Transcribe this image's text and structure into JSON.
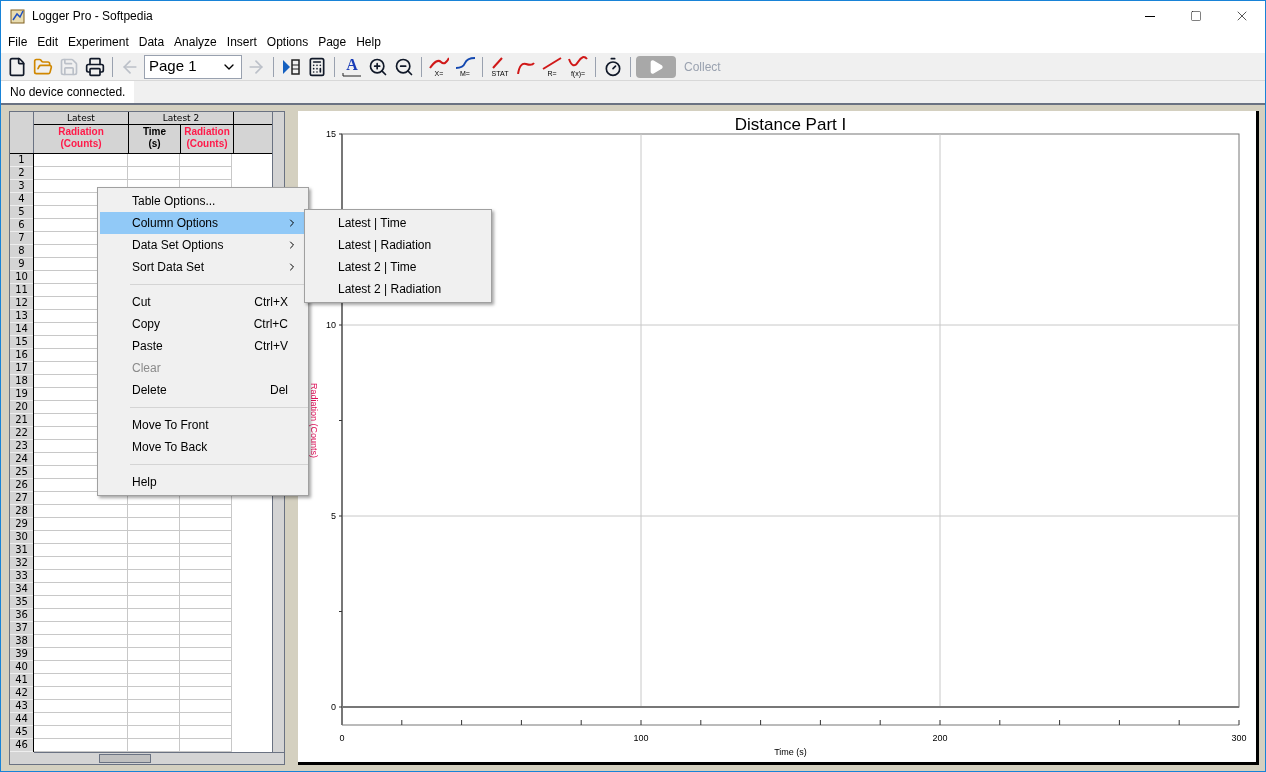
{
  "window": {
    "title": "Logger Pro - Softpedia"
  },
  "menu_bar": [
    "File",
    "Edit",
    "Experiment",
    "Data",
    "Analyze",
    "Insert",
    "Options",
    "Page",
    "Help"
  ],
  "toolbar": [
    {
      "kind": "new",
      "disabled": false
    },
    {
      "kind": "open",
      "disabled": false
    },
    {
      "kind": "save",
      "disabled": true
    },
    {
      "kind": "print",
      "disabled": false
    },
    {
      "kind": "separator"
    },
    {
      "kind": "back",
      "disabled": true
    },
    {
      "kind": "page_select",
      "value": "Page 1"
    },
    {
      "kind": "forward",
      "disabled": true
    },
    {
      "kind": "separator"
    },
    {
      "kind": "table",
      "disabled": false
    },
    {
      "kind": "sensor",
      "disabled": false
    },
    {
      "kind": "separator"
    },
    {
      "kind": "autoscale",
      "label": "A",
      "disabled": false
    },
    {
      "kind": "zoom_in",
      "disabled": false
    },
    {
      "kind": "zoom_out",
      "disabled": false
    },
    {
      "kind": "separator"
    },
    {
      "kind": "tangent",
      "label": "X=",
      "disabled": false
    },
    {
      "kind": "model",
      "label": "M=",
      "disabled": false
    },
    {
      "kind": "separator"
    },
    {
      "kind": "stat",
      "label": "STAT",
      "disabled": false
    },
    {
      "kind": "integral",
      "disabled": false
    },
    {
      "kind": "linear_fit",
      "label": "R=",
      "disabled": false
    },
    {
      "kind": "curve_fit",
      "label": "f(x)=",
      "disabled": false
    },
    {
      "kind": "separator"
    },
    {
      "kind": "timer",
      "disabled": false
    },
    {
      "kind": "separator"
    },
    {
      "kind": "collect",
      "label": "Collect",
      "disabled": true
    }
  ],
  "status": "No device connected.",
  "table": {
    "groups": [
      {
        "label": "Latest",
        "columns": [
          {
            "name": "Radiation",
            "unit": "(Counts)",
            "color": "#ff1a4a"
          }
        ]
      },
      {
        "label": "Latest 2",
        "columns": [
          {
            "name": "Time",
            "unit": "(s)",
            "color": "#000000"
          },
          {
            "name": "Radiation",
            "unit": "(Counts)",
            "color": "#ff1a4a"
          }
        ]
      }
    ],
    "row_numbers": [
      "1",
      "2",
      "3",
      "4",
      "5",
      "6",
      "7",
      "8",
      "9",
      "10",
      "11",
      "12",
      "13",
      "14",
      "15",
      "16",
      "17",
      "18",
      "19",
      "20",
      "21",
      "22",
      "23",
      "24",
      "25",
      "26",
      "27",
      "28",
      "29",
      "30",
      "31",
      "32",
      "33",
      "34",
      "35",
      "36",
      "37",
      "38",
      "39",
      "40",
      "41",
      "42",
      "43",
      "44",
      "45",
      "46"
    ]
  },
  "graph": {
    "chart_data": {
      "type": "line",
      "title": "Distance Part I",
      "xlabel": "Time (s)",
      "ylabel": "Radiation (Counts)",
      "xlim": [
        0,
        300
      ],
      "ylim": [
        0,
        15
      ],
      "xticks": [
        0,
        100,
        200,
        300
      ],
      "yticks": [
        0,
        5,
        10,
        15
      ],
      "grid": true
    }
  },
  "context_menu": {
    "items": [
      {
        "kind": "item",
        "label": "Table Options...",
        "submenu": false,
        "disabled": false,
        "selected": false
      },
      {
        "kind": "item",
        "label": "Column Options",
        "submenu": true,
        "disabled": false,
        "selected": true
      },
      {
        "kind": "item",
        "label": "Data Set Options",
        "submenu": true,
        "disabled": false,
        "selected": false
      },
      {
        "kind": "item",
        "label": "Sort Data Set",
        "submenu": true,
        "disabled": false,
        "selected": false
      },
      {
        "kind": "separator"
      },
      {
        "kind": "item",
        "label": "Cut",
        "shortcut": "Ctrl+X",
        "submenu": false,
        "disabled": false,
        "selected": false
      },
      {
        "kind": "item",
        "label": "Copy",
        "shortcut": "Ctrl+C",
        "submenu": false,
        "disabled": false,
        "selected": false
      },
      {
        "kind": "item",
        "label": "Paste",
        "shortcut": "Ctrl+V",
        "submenu": false,
        "disabled": false,
        "selected": false
      },
      {
        "kind": "item",
        "label": "Clear",
        "submenu": false,
        "disabled": true,
        "selected": false
      },
      {
        "kind": "item",
        "label": "Delete",
        "shortcut": "Del",
        "submenu": false,
        "disabled": false,
        "selected": false
      },
      {
        "kind": "separator"
      },
      {
        "kind": "item",
        "label": "Move To Front",
        "submenu": false,
        "disabled": false,
        "selected": false
      },
      {
        "kind": "item",
        "label": "Move To Back",
        "submenu": false,
        "disabled": false,
        "selected": false
      },
      {
        "kind": "separator"
      },
      {
        "kind": "item",
        "label": "Help",
        "submenu": false,
        "disabled": false,
        "selected": false
      }
    ],
    "submenu": [
      "Latest | Time",
      "Latest | Radiation",
      "Latest 2 | Time",
      "Latest 2 | Radiation"
    ]
  }
}
